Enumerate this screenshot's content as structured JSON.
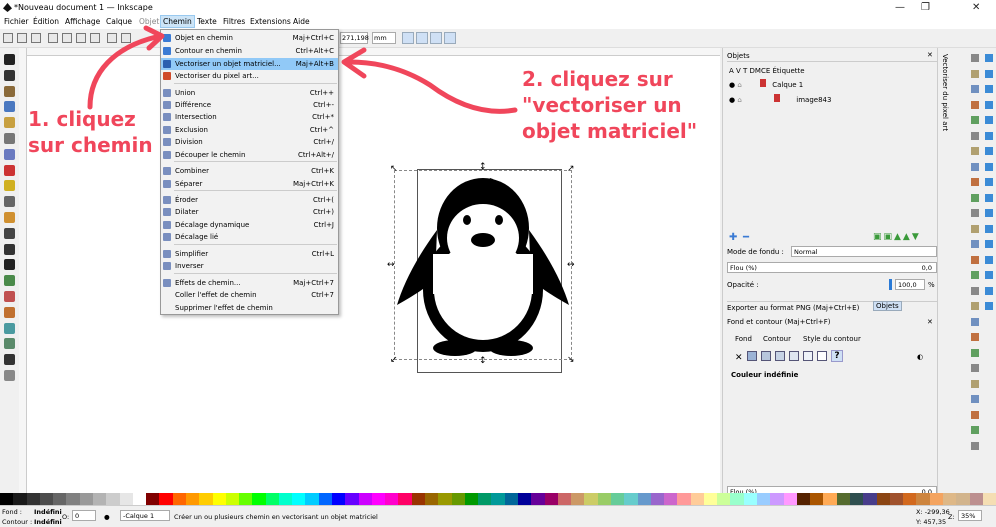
{
  "window": {
    "title": "*Nouveau document 1 — Inkscape"
  },
  "menubar": {
    "items": [
      {
        "label": "Fichier"
      },
      {
        "label": "Édition"
      },
      {
        "label": "Affichage"
      },
      {
        "label": "Calque"
      },
      {
        "label": "Objet"
      },
      {
        "label": "Chemin"
      },
      {
        "label": "Texte"
      },
      {
        "label": "Filtres"
      },
      {
        "label": "Extensions"
      },
      {
        "label": "Aide"
      }
    ],
    "active": "Chemin"
  },
  "toolbar": {
    "width_value": "271,198",
    "unit": "mm"
  },
  "path_menu": {
    "items": [
      {
        "label": "Objet en chemin",
        "shortcut": "Maj+Ctrl+C",
        "icon_color": "#3b7bd4"
      },
      {
        "label": "Contour en chemin",
        "shortcut": "Ctrl+Alt+C",
        "icon_color": "#3b7bd4"
      },
      {
        "label": "Vectoriser un objet matriciel...",
        "shortcut": "Maj+Alt+B",
        "icon_color": "#2b5fb0"
      },
      {
        "label": "Vectoriser du pixel art...",
        "shortcut": "",
        "icon_color": "#d04a2a"
      },
      {
        "label": "Union",
        "shortcut": "Ctrl++",
        "icon_color": "#7a8fbf"
      },
      {
        "label": "Différence",
        "shortcut": "Ctrl+-",
        "icon_color": "#7a8fbf"
      },
      {
        "label": "Intersection",
        "shortcut": "Ctrl+*",
        "icon_color": "#7a8fbf"
      },
      {
        "label": "Exclusion",
        "shortcut": "Ctrl+^",
        "icon_color": "#7a8fbf"
      },
      {
        "label": "Division",
        "shortcut": "Ctrl+/",
        "icon_color": "#7a8fbf"
      },
      {
        "label": "Découper le chemin",
        "shortcut": "Ctrl+Alt+/",
        "icon_color": "#7a8fbf"
      },
      {
        "label": "Combiner",
        "shortcut": "Ctrl+K",
        "icon_color": "#7a8fbf"
      },
      {
        "label": "Séparer",
        "shortcut": "Maj+Ctrl+K",
        "icon_color": "#7a8fbf"
      },
      {
        "label": "Éroder",
        "shortcut": "Ctrl+(",
        "icon_color": "#7a8fbf"
      },
      {
        "label": "Dilater",
        "shortcut": "Ctrl+)",
        "icon_color": "#7a8fbf"
      },
      {
        "label": "Décalage dynamique",
        "shortcut": "Ctrl+J",
        "icon_color": "#7a8fbf"
      },
      {
        "label": "Décalage lié",
        "shortcut": "",
        "icon_color": "#7a8fbf"
      },
      {
        "label": "Simplifier",
        "shortcut": "Ctrl+L",
        "icon_color": "#7a8fbf"
      },
      {
        "label": "Inverser",
        "shortcut": "",
        "icon_color": "#7a8fbf"
      },
      {
        "label": "Effets de chemin...",
        "shortcut": "Maj+Ctrl+7",
        "icon_color": "#7a8fbf"
      },
      {
        "label": "Coller l'effet de chemin",
        "shortcut": "Ctrl+7",
        "icon_color": ""
      },
      {
        "label": "Supprimer l'effet de chemin",
        "shortcut": "",
        "icon_color": ""
      }
    ],
    "highlighted": "Vectoriser un objet matriciel..."
  },
  "annotations": {
    "step1": "1. cliquez\nsur chemin",
    "step2": "2. cliquez sur\n\"vectoriser un\nobjet matriciel\"",
    "color": "#f0465b"
  },
  "objects_panel": {
    "title": "Objets",
    "columns": "A V T DMCE Étiquette",
    "layer": "Calque 1",
    "child": "image843",
    "blend_label": "Mode de fondu :",
    "blend_value": "Normal",
    "blur_label": "Flou (%)",
    "blur_value": "0,0",
    "opacity_label": "Opacité :",
    "opacity_value": "100,0",
    "opacity_unit": "%",
    "export_label": "Exporter au format PNG (Maj+Ctrl+E)",
    "objects_tab": "Objets",
    "fill_stroke_title": "Fond et contour (Maj+Ctrl+F)",
    "tab_fill": "Fond",
    "tab_stroke": "Contour",
    "tab_style": "Style du contour",
    "undefined_color": "Couleur indéfinie",
    "bottom_blur_label": "Flou (%)",
    "bottom_blur_value": "0,0"
  },
  "side_dock": {
    "vertical_title": "Vectoriser du pixel art"
  },
  "statusbar": {
    "fill_label": "Fond :",
    "fill_value": "Indéfini",
    "stroke_label": "Contour :",
    "stroke_value": "Indéfini",
    "opacity_short": "O:",
    "opacity_value": "0",
    "layer_value": "-Calque 1",
    "message": "Créer un ou plusieurs chemin en vectorisant un objet matriciel",
    "x_value": "X: -299,36",
    "y_value": "Y: 457,35",
    "zoom_label": "Z:",
    "zoom_value": "35%"
  },
  "palette": [
    "#000000",
    "#1a1a1a",
    "#333333",
    "#4d4d4d",
    "#666666",
    "#808080",
    "#999999",
    "#b3b3b3",
    "#cccccc",
    "#e6e6e6",
    "#ffffff",
    "#800000",
    "#ff0000",
    "#ff6600",
    "#ff9900",
    "#ffcc00",
    "#ffff00",
    "#ccff00",
    "#66ff00",
    "#00ff00",
    "#00ff66",
    "#00ffcc",
    "#00ffff",
    "#00ccff",
    "#0066ff",
    "#0000ff",
    "#6600ff",
    "#cc00ff",
    "#ff00ff",
    "#ff00cc",
    "#ff0066",
    "#993300",
    "#996600",
    "#999900",
    "#669900",
    "#009900",
    "#009966",
    "#009999",
    "#006699",
    "#000099",
    "#660099",
    "#990066",
    "#cc6666",
    "#cc9966",
    "#cccc66",
    "#99cc66",
    "#66cc99",
    "#66cccc",
    "#6699cc",
    "#9966cc",
    "#cc66cc",
    "#ff9999",
    "#ffcc99",
    "#ffff99",
    "#ccff99",
    "#99ffcc",
    "#99ffff",
    "#99ccff",
    "#cc99ff",
    "#ff99ff",
    "#552200",
    "#aa5500",
    "#ffaa55",
    "#556b2f",
    "#2f4f4f",
    "#483d8b",
    "#8b4513",
    "#a0522d",
    "#d2691e",
    "#cd853f",
    "#f4a460",
    "#deb887",
    "#d2b48c",
    "#bc8f8f",
    "#f5deb3"
  ]
}
